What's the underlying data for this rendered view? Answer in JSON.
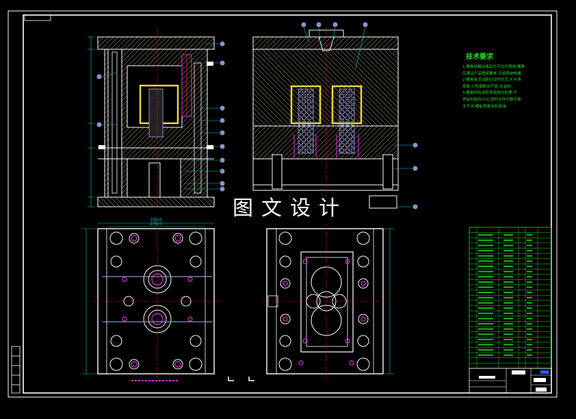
{
  "watermark": "图文设计",
  "technical_requirements": {
    "title": "技术要求",
    "notes": [
      "1.模具试模合格后方可交付使用,模具",
      "应满足产品图纸要求,冷却系统畅通。",
      "2.模具各活动部位动作灵活,无卡滞",
      "现象,分型面配合严密,无溢料。",
      "3.模具所有成型表面抛光处理,不",
      "得有划痕及凹坑,顶杆动作平稳可靠",
      "无干涉,模板表面涂防锈油。"
    ]
  },
  "dimensions": {
    "overall_width_outer": "330.0",
    "overall_width_inner": "270.0"
  },
  "colors": {
    "frame": "#ffffff",
    "outline": "#ffffff",
    "hatch": "#c8a878",
    "cavity": "#e8d838",
    "callout": "#7f7ff5",
    "leader": "#00d0d0",
    "centerline": "#e01818",
    "bolt": "#e030e0",
    "part_table": "#22dd22",
    "text_green": "#22dd22",
    "insert": "#9090d0"
  }
}
